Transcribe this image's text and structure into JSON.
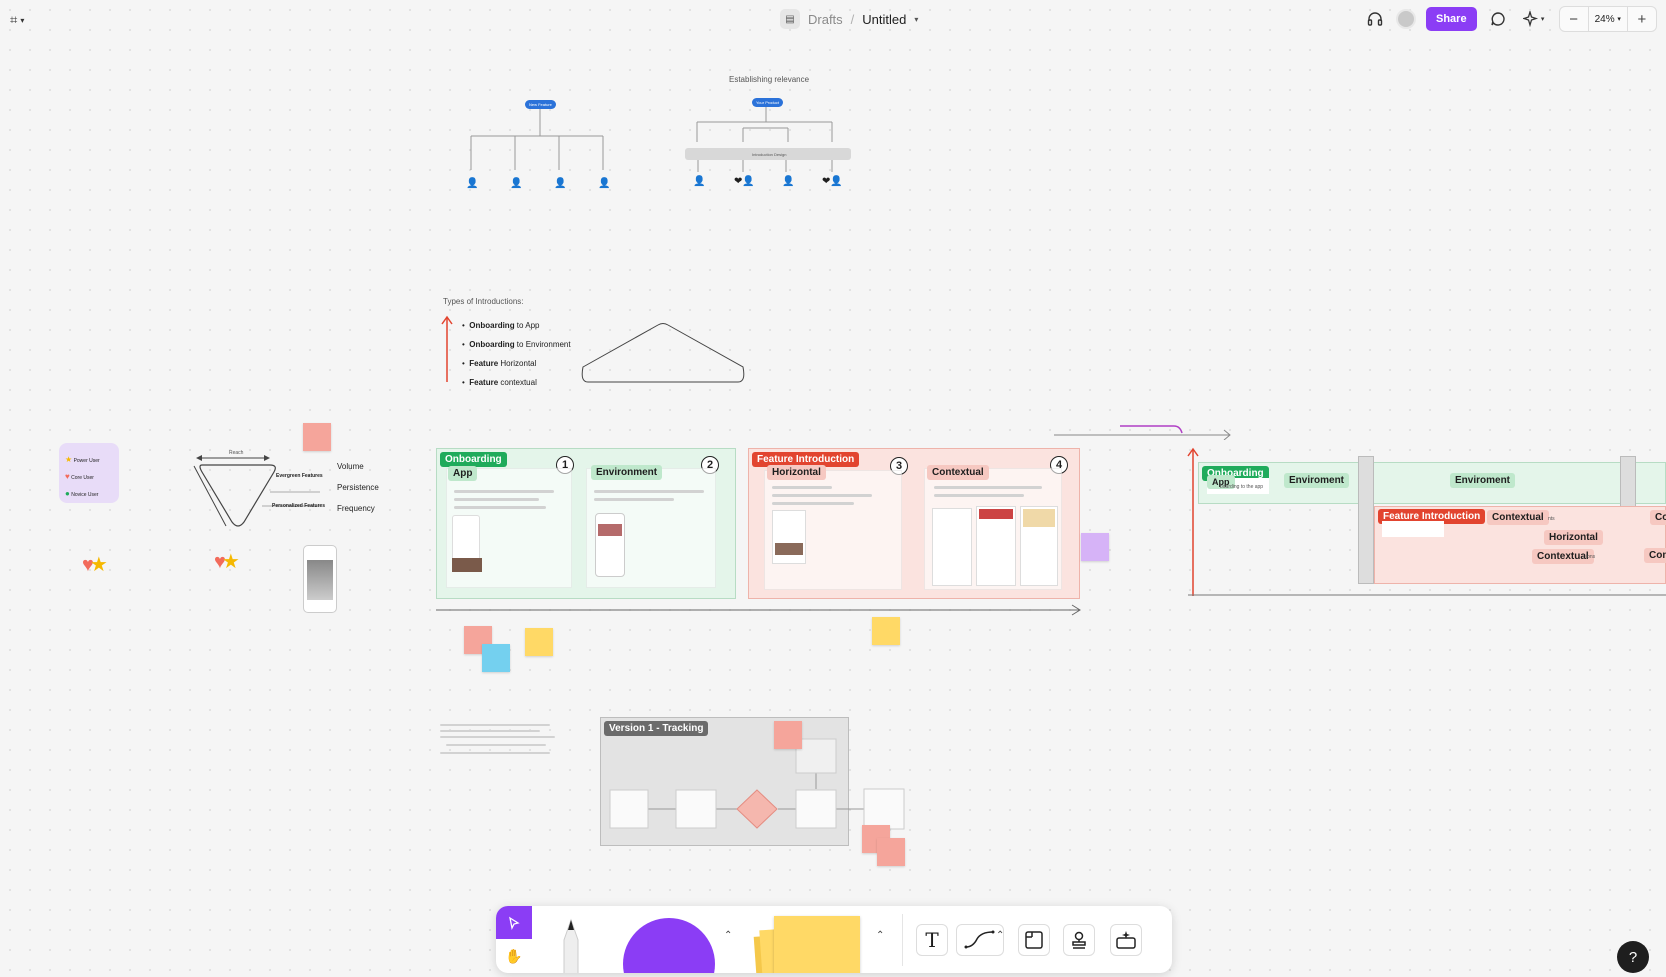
{
  "app": {
    "menu_glyph": "⌗",
    "breadcrumb": {
      "folder": "Drafts",
      "separator": "/",
      "title": "Untitled"
    },
    "share_label": "Share",
    "zoom": "24%",
    "zoom_out": "−",
    "zoom_in": "+",
    "help": "?"
  },
  "canvas": {
    "establishing_relevance": "Establishing relevance",
    "node_left": "New Feature",
    "node_right": "Your Product",
    "intro_design": "Introduction Design",
    "types_title": "Types of Introductions:",
    "types": [
      {
        "bold": "Onboarding",
        "rest": " to App"
      },
      {
        "bold": "Onboarding",
        "rest": " to Environment"
      },
      {
        "bold": "Feature",
        "rest": " Horizontal"
      },
      {
        "bold": "Feature",
        "rest": " contextual"
      }
    ],
    "legend": [
      {
        "label": "Power User",
        "color": "#f5b800"
      },
      {
        "label": "Core User",
        "color": "#f26b5b"
      },
      {
        "label": "Novice User",
        "color": "#1fab5b"
      }
    ],
    "funnel": {
      "reach": "Reach",
      "evergreen": "Evergreen Features",
      "personalized": "Personalized Features"
    },
    "metrics": [
      "Volume",
      "Persistence",
      "Frequency"
    ],
    "sections": {
      "onboarding": "Onboarding",
      "app": "App",
      "environment": "Environment",
      "feature_intro": "Feature Introduction",
      "horizontal": "Horizontal",
      "contextual": "Contextual",
      "nums": [
        "1",
        "2",
        "3",
        "4"
      ]
    },
    "right_board": {
      "onboarding": "Onboarding",
      "app": "App",
      "app_sub": "boarding to the app",
      "enviroment1": "Enviroment",
      "enviroment2": "Enviroment",
      "feature_intro": "Feature Introduction",
      "contextual_a": "Contextual",
      "contextual_b": "Contextual",
      "horizontal": "Horizontal",
      "contextual_c": "Contextual",
      "cont_edge_1": "Co",
      "cont_edge_2": "Cont",
      "ions": "ions",
      "nts": "nts"
    },
    "version_title": "Version 1 - Tracking"
  },
  "colors": {
    "accent": "#8b3df5",
    "onboarding_green": "#1fab5b",
    "feature_red": "#e2442f",
    "sticky_yellow": "#ffd966",
    "sticky_red": "#f5a59b",
    "sticky_blue": "#74d0ef",
    "sticky_purple": "#d6b3f7"
  },
  "icons": [
    "figma-menu-icon",
    "headphones-icon",
    "comment-icon",
    "sparkle-icon",
    "cursor-icon",
    "hand-icon",
    "pen-icon",
    "shape-icon",
    "sticky-icon",
    "text-icon",
    "connector-icon",
    "section-icon",
    "stamp-icon",
    "ai-icon"
  ]
}
